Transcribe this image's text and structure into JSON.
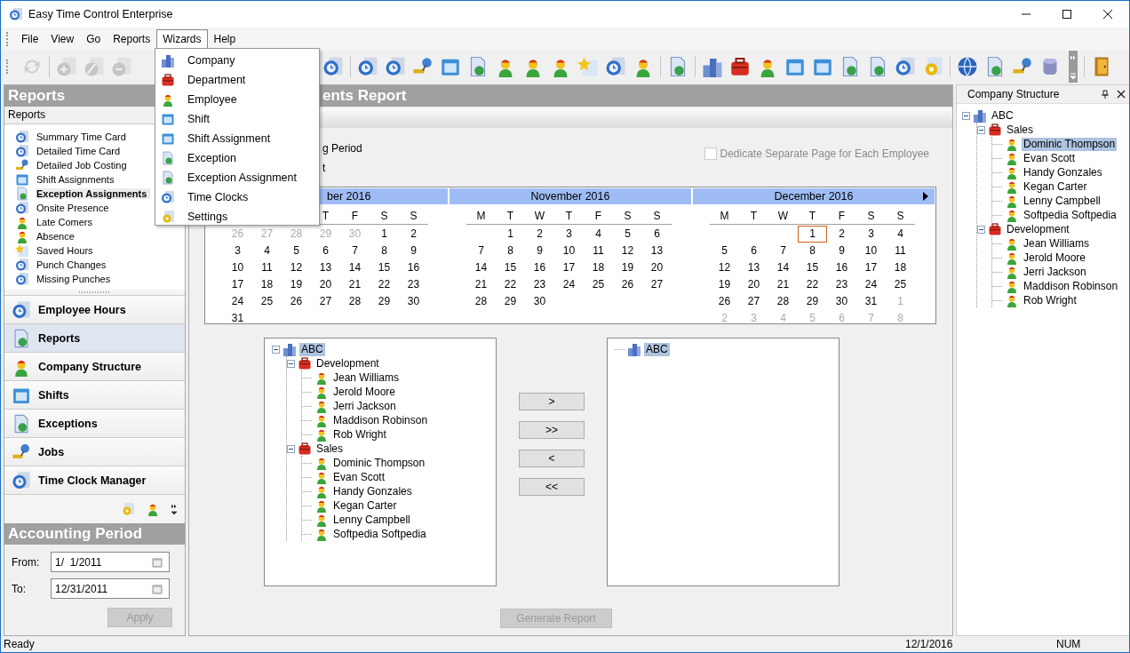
{
  "window": {
    "title": "Easy Time Control Enterprise"
  },
  "menu_bar": [
    {
      "label": "File",
      "selected": false
    },
    {
      "label": "View",
      "selected": false
    },
    {
      "label": "Go",
      "selected": false
    },
    {
      "label": "Reports",
      "selected": false
    },
    {
      "label": "Wizards",
      "selected": true
    },
    {
      "label": "Help",
      "selected": false
    }
  ],
  "wizards_menu": [
    {
      "label": "Company"
    },
    {
      "label": "Department"
    },
    {
      "label": "Employee"
    },
    {
      "label": "Shift"
    },
    {
      "label": "Shift Assignment"
    },
    {
      "label": "Exception"
    },
    {
      "label": "Exception Assignment"
    },
    {
      "label": "Time Clocks"
    },
    {
      "label": "Settings"
    }
  ],
  "reports_panel": {
    "title": "Reports",
    "subtitle": "Reports",
    "items": [
      {
        "label": "Summary Time Card",
        "selected": false
      },
      {
        "label": "Detailed Time Card",
        "selected": false
      },
      {
        "label": "Detailed Job Costing",
        "selected": false
      },
      {
        "label": "Shift Assignments",
        "selected": false
      },
      {
        "label": "Exception Assignments",
        "selected": true
      },
      {
        "label": "Onsite Presence",
        "selected": false
      },
      {
        "label": "Late Comers",
        "selected": false
      },
      {
        "label": "Absence",
        "selected": false
      },
      {
        "label": "Saved Hours",
        "selected": false
      },
      {
        "label": "Punch Changes",
        "selected": false
      },
      {
        "label": "Missing Punches",
        "selected": false
      }
    ]
  },
  "nav_buttons": [
    {
      "label": "Employee Hours",
      "selected": false
    },
    {
      "label": "Reports",
      "selected": true
    },
    {
      "label": "Company Structure",
      "selected": false
    },
    {
      "label": "Shifts",
      "selected": false
    },
    {
      "label": "Exceptions",
      "selected": false
    },
    {
      "label": "Jobs",
      "selected": false
    },
    {
      "label": "Time Clock Manager",
      "selected": false
    }
  ],
  "accounting_period": {
    "title": "Accounting Period",
    "from_label": "From:",
    "from": "1/  1/2011",
    "to_label": "To:",
    "to": "12/31/2011",
    "apply": {
      "label": "Apply",
      "disabled": true
    }
  },
  "report": {
    "title": "ents Report",
    "options": [
      "g Period",
      "t"
    ],
    "separate_page": {
      "label": "Dedicate Separate Page for Each Employee",
      "checked": false,
      "disabled": true
    },
    "calendars": [
      {
        "title": "ber 2016",
        "weekdays": [
          "T",
          "F",
          "S",
          "S"
        ],
        "weeks": [
          [
            {
              "day": "26",
              "other": true
            },
            {
              "day": "27",
              "other": true
            },
            {
              "day": "28",
              "other": true
            },
            {
              "day": "29",
              "other": true
            },
            {
              "day": "30",
              "other": true
            },
            {
              "day": "1",
              "other": false
            },
            {
              "day": "2",
              "other": false
            }
          ],
          [
            {
              "day": "3",
              "other": false
            },
            {
              "day": "4",
              "other": false
            },
            {
              "day": "5",
              "other": false
            },
            {
              "day": "6",
              "other": false
            },
            {
              "day": "7",
              "other": false
            },
            {
              "day": "8",
              "other": false
            },
            {
              "day": "9",
              "other": false
            }
          ],
          [
            {
              "day": "10",
              "other": false
            },
            {
              "day": "11",
              "other": false
            },
            {
              "day": "12",
              "other": false
            },
            {
              "day": "13",
              "other": false
            },
            {
              "day": "14",
              "other": false
            },
            {
              "day": "15",
              "other": false
            },
            {
              "day": "16",
              "other": false
            }
          ],
          [
            {
              "day": "17",
              "other": false
            },
            {
              "day": "18",
              "other": false
            },
            {
              "day": "19",
              "other": false
            },
            {
              "day": "20",
              "other": false
            },
            {
              "day": "21",
              "other": false
            },
            {
              "day": "22",
              "other": false
            },
            {
              "day": "23",
              "other": false
            }
          ],
          [
            {
              "day": "24",
              "other": false
            },
            {
              "day": "25",
              "other": false
            },
            {
              "day": "26",
              "other": false
            },
            {
              "day": "27",
              "other": false
            },
            {
              "day": "28",
              "other": false
            },
            {
              "day": "29",
              "other": false
            },
            {
              "day": "30",
              "other": false
            }
          ],
          [
            {
              "day": "31",
              "other": false
            }
          ]
        ]
      },
      {
        "title": "November 2016",
        "weekdays": [
          "M",
          "T",
          "W",
          "T",
          "F",
          "S",
          "S"
        ],
        "weeks": [
          [
            {
              "day": "1",
              "other": false
            },
            {
              "day": "2",
              "other": false
            },
            {
              "day": "3",
              "other": false
            },
            {
              "day": "4",
              "other": false
            },
            {
              "day": "5",
              "other": false
            },
            {
              "day": "6",
              "other": false
            }
          ],
          [
            {
              "day": "7",
              "other": false
            },
            {
              "day": "8",
              "other": false
            },
            {
              "day": "9",
              "other": false
            },
            {
              "day": "10",
              "other": false
            },
            {
              "day": "11",
              "other": false
            },
            {
              "day": "12",
              "other": false
            },
            {
              "day": "13",
              "other": false
            }
          ],
          [
            {
              "day": "14",
              "other": false
            },
            {
              "day": "15",
              "other": false
            },
            {
              "day": "16",
              "other": false
            },
            {
              "day": "17",
              "other": false
            },
            {
              "day": "18",
              "other": false
            },
            {
              "day": "19",
              "other": false
            },
            {
              "day": "20",
              "other": false
            }
          ],
          [
            {
              "day": "21",
              "other": false
            },
            {
              "day": "22",
              "other": false
            },
            {
              "day": "23",
              "other": false
            },
            {
              "day": "24",
              "other": false
            },
            {
              "day": "25",
              "other": false
            },
            {
              "day": "26",
              "other": false
            },
            {
              "day": "27",
              "other": false
            }
          ],
          [
            {
              "day": "28",
              "other": false
            },
            {
              "day": "29",
              "other": false
            },
            {
              "day": "30",
              "other": false
            }
          ]
        ]
      },
      {
        "title": "December 2016",
        "weekdays": [
          "M",
          "T",
          "W",
          "T",
          "F",
          "S",
          "S"
        ],
        "weeks": [
          [
            {
              "day": "1",
              "other": false,
              "today": true
            },
            {
              "day": "2",
              "other": false,
              "today": false
            },
            {
              "day": "3",
              "other": false,
              "today": false
            },
            {
              "day": "4",
              "other": false,
              "today": false
            }
          ],
          [
            {
              "day": "5",
              "other": false
            },
            {
              "day": "6",
              "other": false
            },
            {
              "day": "7",
              "other": false
            },
            {
              "day": "8",
              "other": false
            },
            {
              "day": "9",
              "other": false
            },
            {
              "day": "10",
              "other": false
            },
            {
              "day": "11",
              "other": false
            }
          ],
          [
            {
              "day": "12",
              "other": false
            },
            {
              "day": "13",
              "other": false
            },
            {
              "day": "14",
              "other": false
            },
            {
              "day": "15",
              "other": false
            },
            {
              "day": "16",
              "other": false
            },
            {
              "day": "17",
              "other": false
            },
            {
              "day": "18",
              "other": false
            }
          ],
          [
            {
              "day": "19",
              "other": false
            },
            {
              "day": "20",
              "other": false
            },
            {
              "day": "21",
              "other": false
            },
            {
              "day": "22",
              "other": false
            },
            {
              "day": "23",
              "other": false
            },
            {
              "day": "24",
              "other": false
            },
            {
              "day": "25",
              "other": false
            }
          ],
          [
            {
              "day": "26",
              "other": false
            },
            {
              "day": "27",
              "other": false
            },
            {
              "day": "28",
              "other": false
            },
            {
              "day": "29",
              "other": false
            },
            {
              "day": "30",
              "other": false
            },
            {
              "day": "31",
              "other": false
            },
            {
              "day": "1",
              "other": true
            }
          ],
          [
            {
              "day": "2",
              "other": true
            },
            {
              "day": "3",
              "other": true
            },
            {
              "day": "4",
              "other": true
            },
            {
              "day": "5",
              "other": true
            },
            {
              "day": "6",
              "other": true
            },
            {
              "day": "7",
              "other": true
            },
            {
              "day": "8",
              "other": true
            }
          ]
        ]
      }
    ],
    "available_tree": [
      {
        "label": "ABC",
        "kind": "company",
        "selected": true,
        "expanded": true,
        "children": [
          {
            "label": "Development",
            "kind": "department",
            "selected": false,
            "expanded": true,
            "children": [
              {
                "label": "Jean Williams",
                "kind": "employee",
                "selected": false
              },
              {
                "label": "Jerold Moore",
                "kind": "employee",
                "selected": false
              },
              {
                "label": "Jerri Jackson",
                "kind": "employee",
                "selected": false
              },
              {
                "label": "Maddison Robinson",
                "kind": "employee",
                "selected": false
              },
              {
                "label": "Rob Wright",
                "kind": "employee",
                "selected": false
              }
            ]
          },
          {
            "label": "Sales",
            "kind": "department",
            "selected": false,
            "expanded": true,
            "children": [
              {
                "label": "Dominic Thompson",
                "kind": "employee",
                "selected": false
              },
              {
                "label": "Evan Scott",
                "kind": "employee",
                "selected": false
              },
              {
                "label": "Handy Gonzales",
                "kind": "employee",
                "selected": false
              },
              {
                "label": "Kegan Carter",
                "kind": "employee",
                "selected": false
              },
              {
                "label": "Lenny Campbell",
                "kind": "employee",
                "selected": false
              },
              {
                "label": "Softpedia Softpedia",
                "kind": "employee",
                "selected": false
              }
            ]
          }
        ]
      }
    ],
    "selected_tree": [
      {
        "label": "ABC",
        "kind": "company",
        "selected": true
      }
    ],
    "move_buttons": [
      ">",
      ">>",
      "<",
      "<<"
    ],
    "generate": {
      "label": "Generate Report",
      "disabled": true
    }
  },
  "company_structure": {
    "title": "Company Structure",
    "tree": [
      {
        "label": "ABC",
        "kind": "company",
        "selected": false,
        "expanded": true,
        "children": [
          {
            "label": "Sales",
            "kind": "department",
            "selected": false,
            "expanded": true,
            "children": [
              {
                "label": "Dominic Thompson",
                "kind": "employee",
                "selected": true
              },
              {
                "label": "Evan Scott",
                "kind": "employee",
                "selected": false
              },
              {
                "label": "Handy Gonzales",
                "kind": "employee",
                "selected": false
              },
              {
                "label": "Kegan Carter",
                "kind": "employee",
                "selected": false
              },
              {
                "label": "Lenny Campbell",
                "kind": "employee",
                "selected": false
              },
              {
                "label": "Softpedia Softpedia",
                "kind": "employee",
                "selected": false
              }
            ]
          },
          {
            "label": "Development",
            "kind": "department",
            "selected": false,
            "expanded": true,
            "children": [
              {
                "label": "Jean Williams",
                "kind": "employee",
                "selected": false
              },
              {
                "label": "Jerold Moore",
                "kind": "employee",
                "selected": false
              },
              {
                "label": "Jerri Jackson",
                "kind": "employee",
                "selected": false
              },
              {
                "label": "Maddison Robinson",
                "kind": "employee",
                "selected": false
              },
              {
                "label": "Rob Wright",
                "kind": "employee",
                "selected": false
              }
            ]
          }
        ]
      }
    ]
  },
  "status_bar": {
    "message": "Ready",
    "date": "12/1/2016",
    "indicator": "NUM"
  }
}
